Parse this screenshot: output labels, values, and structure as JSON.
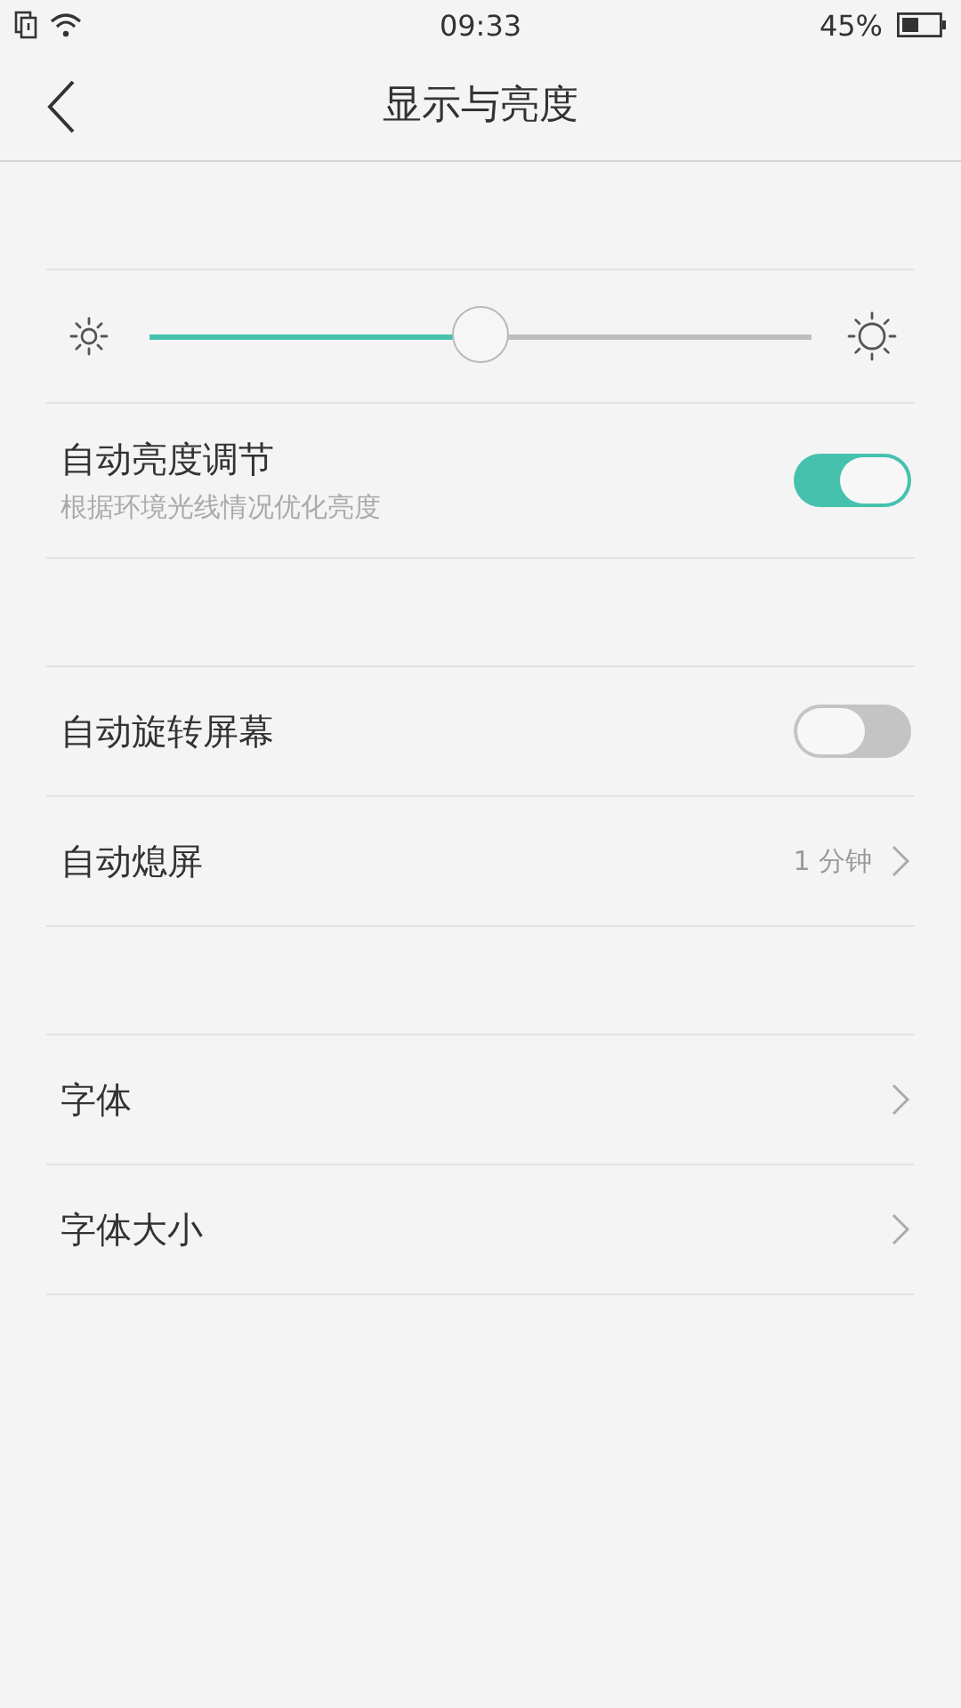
{
  "status_bar": {
    "time": "09:33",
    "battery_text": "45%"
  },
  "header": {
    "title": "显示与亮度"
  },
  "groups": [
    {
      "items": [
        {
          "kind": "slider",
          "level": 0.5
        },
        {
          "kind": "toggle",
          "label": "自动亮度调节",
          "subtitle": "根据环境光线情况优化亮度",
          "on": true
        }
      ]
    },
    {
      "items": [
        {
          "kind": "toggle",
          "label": "自动旋转屏幕",
          "on": false
        },
        {
          "kind": "link",
          "label": "自动熄屏",
          "value": "1 分钟"
        }
      ]
    },
    {
      "items": [
        {
          "kind": "link",
          "label": "字体"
        },
        {
          "kind": "link",
          "label": "字体大小"
        }
      ]
    }
  ]
}
